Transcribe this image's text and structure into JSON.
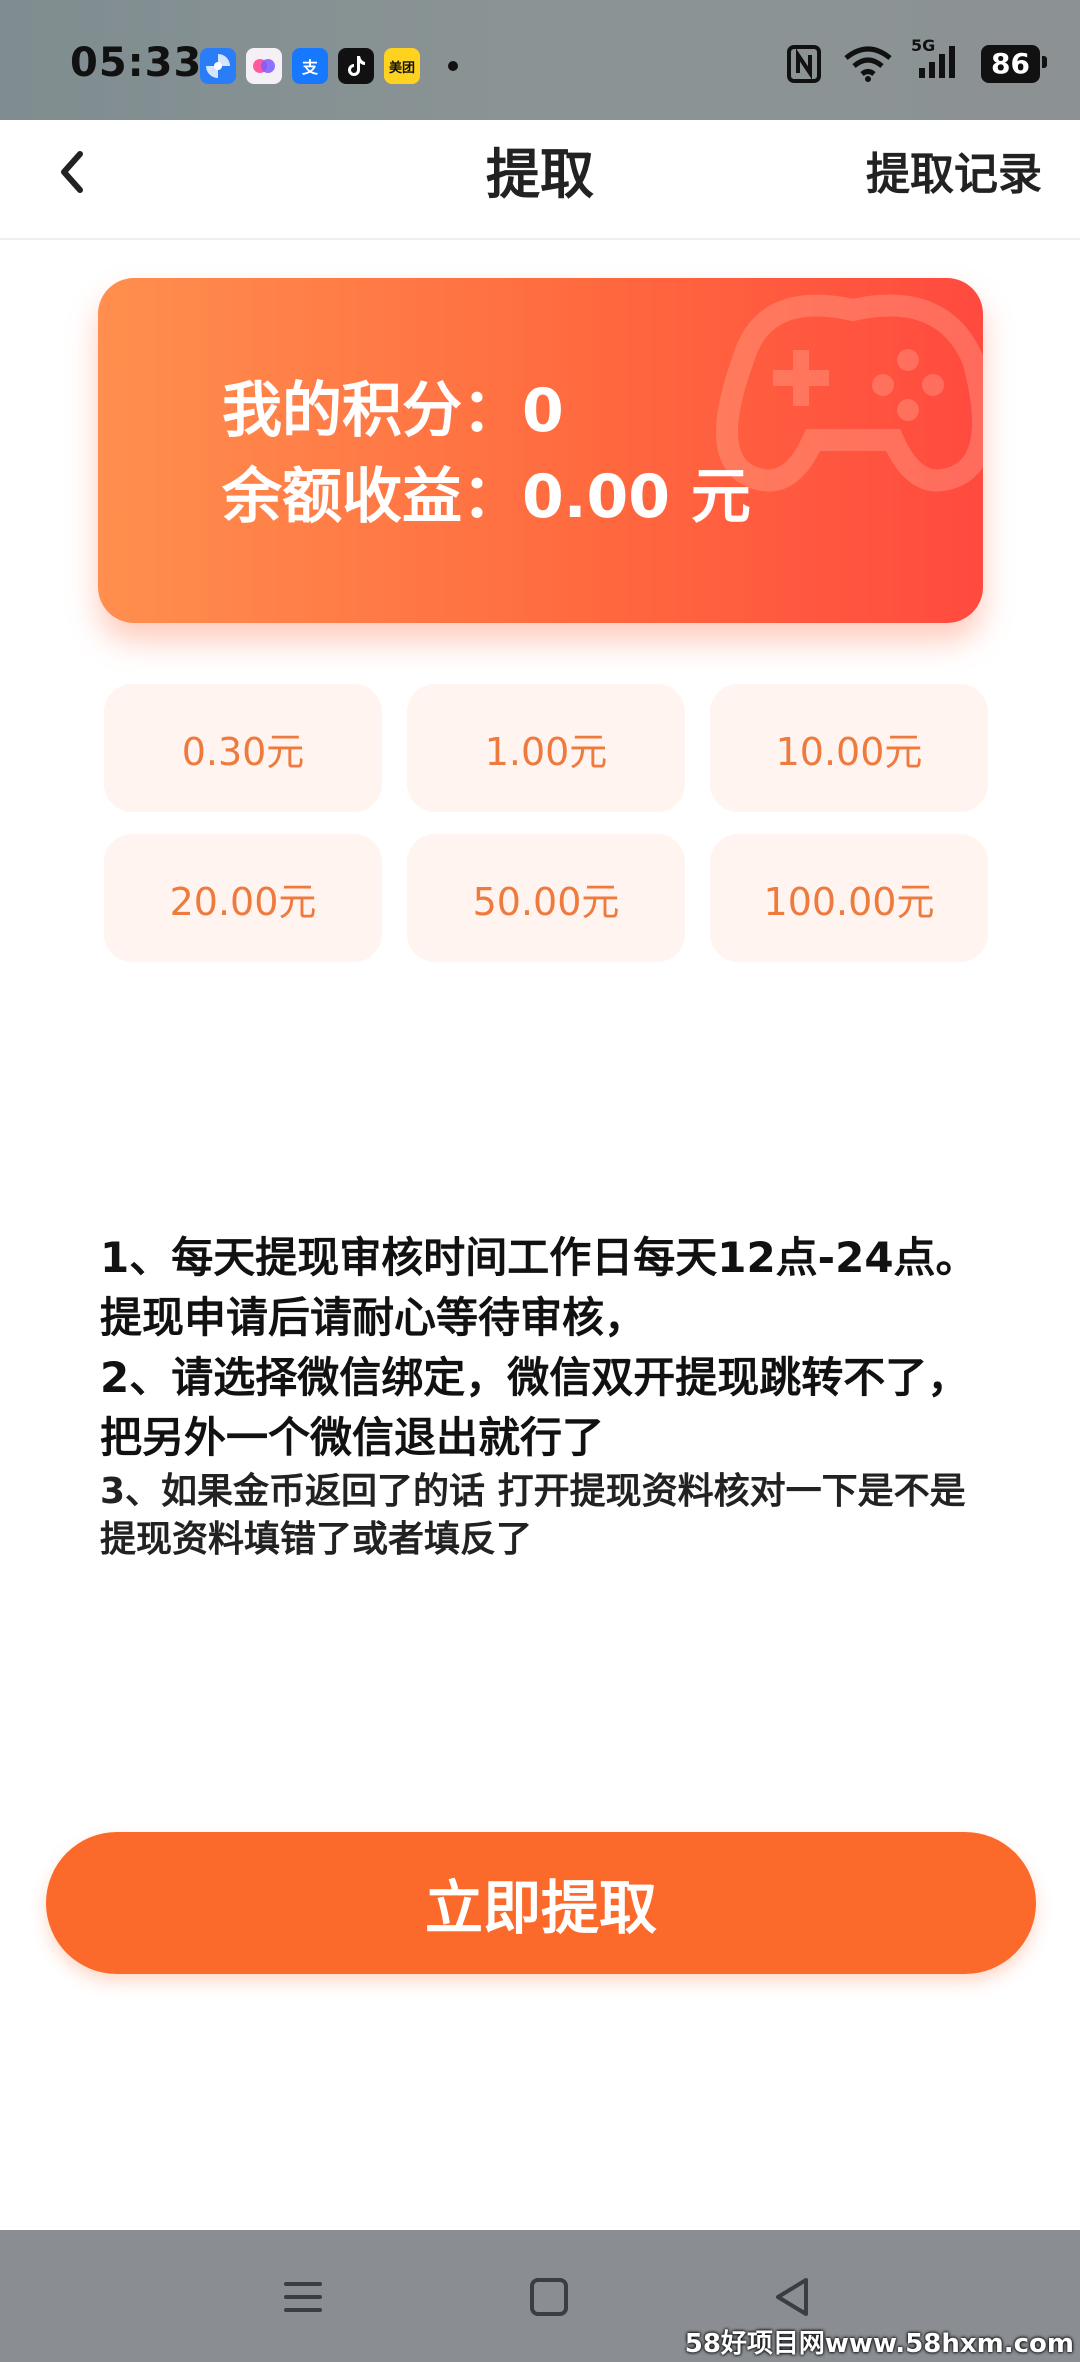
{
  "status_bar": {
    "time": "05:33",
    "network": "5G",
    "battery": "86",
    "app_icons": [
      {
        "name": "pinwheel-app-icon",
        "color": "#2a7cf7"
      },
      {
        "name": "colorful-app-icon",
        "color": "#f5f0f5"
      },
      {
        "name": "alipay-app-icon",
        "color": "#1677ff",
        "text": "支"
      },
      {
        "name": "tiktok-app-icon",
        "color": "#111111"
      },
      {
        "name": "meituan-app-icon",
        "color": "#ffd21f",
        "text": "美团"
      }
    ]
  },
  "header": {
    "title": "提取",
    "records_label": "提取记录"
  },
  "card": {
    "points_text": "我的积分：0",
    "balance_text": "余额收益：0.00 元"
  },
  "amounts": [
    "0.30元",
    "1.00元",
    "10.00元",
    "20.00元",
    "50.00元",
    "100.00元"
  ],
  "notes": {
    "note1": "1、每天提现审核时间工作日每天12点-24点。提现申请后请耐心等待审核，",
    "note2": "2、请选择微信绑定，微信双开提现跳转不了，把另外一个微信退出就行了",
    "note3": "3、如果金币返回了的话 打开提现资料核对一下是不是提现资料填错了或者填反了"
  },
  "submit_label": "立即提取",
  "watermark": "58好项目网www.58hxm.com",
  "colors": {
    "accent": "#fb6a2a",
    "amount_text": "#ef7a3d",
    "amount_bg": "#fff4ef"
  }
}
